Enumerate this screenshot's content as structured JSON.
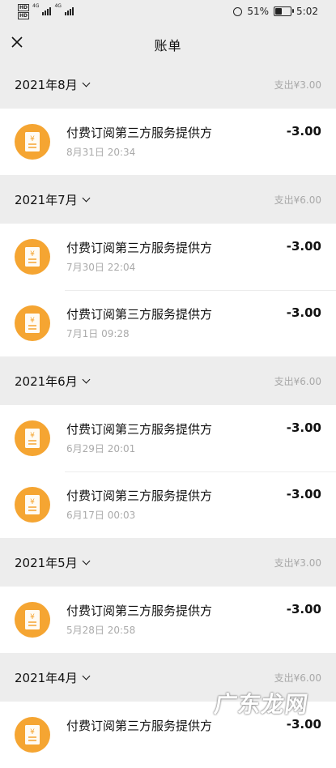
{
  "status_bar": {
    "left_tags": [
      "HD",
      "HD"
    ],
    "network_labels": [
      "4G",
      "4G"
    ],
    "battery_percent": "51%",
    "battery_level": 0.51,
    "time": "5:02"
  },
  "navbar": {
    "title": "账单"
  },
  "months": [
    {
      "label": "2021年8月",
      "total": "支出¥3.00",
      "items": [
        {
          "title": "付费订阅第三方服务提供方",
          "date": "8月31日 20:34",
          "amount": "-3.00"
        }
      ]
    },
    {
      "label": "2021年7月",
      "total": "支出¥6.00",
      "items": [
        {
          "title": "付费订阅第三方服务提供方",
          "date": "7月30日 22:04",
          "amount": "-3.00"
        },
        {
          "title": "付费订阅第三方服务提供方",
          "date": "7月1日 09:28",
          "amount": "-3.00"
        }
      ]
    },
    {
      "label": "2021年6月",
      "total": "支出¥6.00",
      "items": [
        {
          "title": "付费订阅第三方服务提供方",
          "date": "6月29日 20:01",
          "amount": "-3.00"
        },
        {
          "title": "付费订阅第三方服务提供方",
          "date": "6月17日 00:03",
          "amount": "-3.00"
        }
      ]
    },
    {
      "label": "2021年5月",
      "total": "支出¥3.00",
      "items": [
        {
          "title": "付费订阅第三方服务提供方",
          "date": "5月28日 20:58",
          "amount": "-3.00"
        }
      ]
    },
    {
      "label": "2021年4月",
      "total": "支出¥6.00",
      "items": [
        {
          "title": "付费订阅第三方服务提供方",
          "date": "",
          "amount": "-3.00"
        }
      ]
    }
  ],
  "icons": {
    "close": "close-icon",
    "item": "yuan-receipt-icon",
    "month_toggle": "chevron-down-icon"
  },
  "colors": {
    "background": "#ededed",
    "icon_orange": "#f5a532",
    "secondary_text": "#a8a8a8"
  },
  "watermark": "广东龙网"
}
